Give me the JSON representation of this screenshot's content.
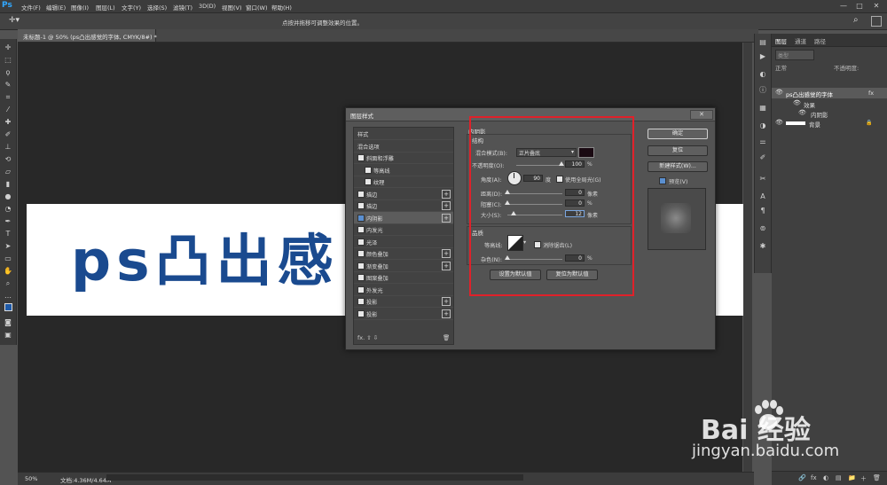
{
  "menubar": {
    "logo": "Ps",
    "items": [
      "文件(F)",
      "编辑(E)",
      "图像(I)",
      "图层(L)",
      "文字(Y)",
      "选择(S)",
      "滤镜(T)",
      "3D(D)",
      "视图(V)",
      "窗口(W)",
      "帮助(H)"
    ],
    "window_buttons": [
      "—",
      "□",
      "✕"
    ]
  },
  "optionsbar": {
    "hint": "点按并拖移可调整效果的位置。"
  },
  "document": {
    "tab_title": "未标题-1 @ 50% (ps凸出感觉的字体, CMYK/8#) *",
    "canvas_text": "ps凸出感",
    "zoom": "50%",
    "doc_info": "文档:4.36M/4.64M"
  },
  "layers_panel": {
    "tabs": [
      "图层",
      "通道",
      "路径"
    ],
    "search_placeholder": "类型",
    "blend_mode": "正常",
    "opacity_label": "不透明度:",
    "layers": [
      {
        "name": "ps凸出感觉的字体",
        "fx": "fx"
      },
      {
        "name": "效果"
      },
      {
        "name": "内阴影"
      },
      {
        "name": "背景",
        "lock": "🔒"
      }
    ],
    "bottom_icons": [
      "🔗",
      "fx",
      "◐",
      "▤",
      "📁",
      "＋",
      "🗑"
    ]
  },
  "dialog": {
    "title": "图层样式",
    "close_label": "✕",
    "styles": [
      {
        "label": "样式",
        "checkbox": false,
        "plus": false
      },
      {
        "label": "混合选项",
        "checkbox": false,
        "plus": false
      },
      {
        "label": "斜面和浮雕",
        "checkbox": true,
        "checked": false,
        "plus": false
      },
      {
        "label": "等高线",
        "checkbox": true,
        "checked": false,
        "plus": false,
        "indent": true
      },
      {
        "label": "纹理",
        "checkbox": true,
        "checked": false,
        "plus": false,
        "indent": true
      },
      {
        "label": "描边",
        "checkbox": true,
        "checked": false,
        "plus": true
      },
      {
        "label": "描边",
        "checkbox": true,
        "checked": false,
        "plus": true
      },
      {
        "label": "内阴影",
        "checkbox": true,
        "checked": true,
        "plus": true,
        "selected": true
      },
      {
        "label": "内发光",
        "checkbox": true,
        "checked": false,
        "plus": false
      },
      {
        "label": "光泽",
        "checkbox": true,
        "checked": false,
        "plus": false
      },
      {
        "label": "颜色叠加",
        "checkbox": true,
        "checked": false,
        "plus": true
      },
      {
        "label": "渐变叠加",
        "checkbox": true,
        "checked": false,
        "plus": true
      },
      {
        "label": "图案叠加",
        "checkbox": true,
        "checked": false,
        "plus": false
      },
      {
        "label": "外发光",
        "checkbox": true,
        "checked": false,
        "plus": false
      },
      {
        "label": "投影",
        "checkbox": true,
        "checked": false,
        "plus": true
      },
      {
        "label": "投影",
        "checkbox": true,
        "checked": false,
        "plus": true
      }
    ],
    "footer_icons": "fx.  ⇧  ⇩",
    "trash_icon": "🗑",
    "inner_shadow": {
      "section_title": "内阴影",
      "structure_title": "结构",
      "blend_label": "混合模式(B):",
      "blend_value": "正片叠底",
      "blend_color": "#1a0a12",
      "opacity_label": "不透明度(O):",
      "opacity_value": "100",
      "opacity_unit": "%",
      "angle_label": "角度(A):",
      "angle_value": "90",
      "angle_unit": "度",
      "global_light_label": "使用全局光(G)",
      "distance_label": "距离(D):",
      "distance_value": "0",
      "distance_unit": "像素",
      "choke_label": "阻塞(C):",
      "choke_value": "0",
      "choke_unit": "%",
      "size_label": "大小(S):",
      "size_value": "12",
      "size_unit": "像素",
      "quality_title": "品质",
      "contour_label": "等高线:",
      "antialias_label": "消除锯齿(L)",
      "noise_label": "杂色(N):",
      "noise_value": "0",
      "noise_unit": "%",
      "set_default_label": "设置为默认值",
      "reset_default_label": "复位为默认值"
    },
    "buttons": {
      "ok": "确定",
      "reset": "复位",
      "new_style": "新建样式(W)...",
      "preview_label": "预览(V)"
    }
  },
  "watermark": {
    "brand": "Bai 经验",
    "url": "jingyan.baidu.com"
  }
}
